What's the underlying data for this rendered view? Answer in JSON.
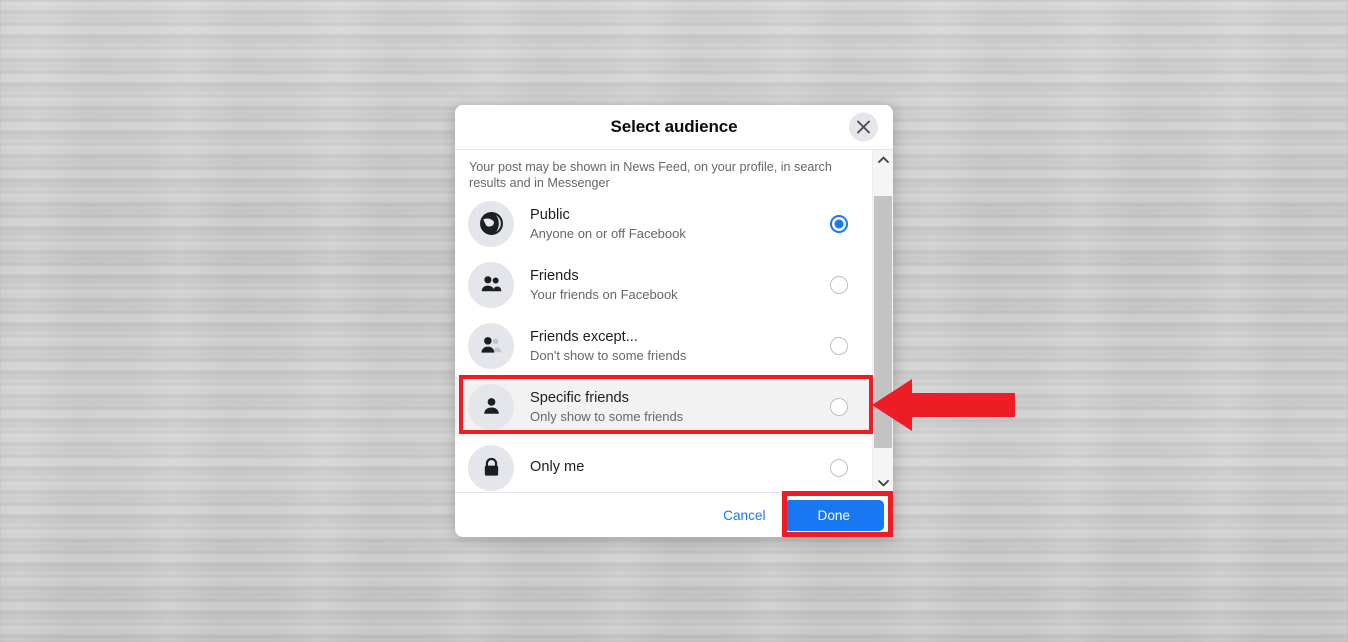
{
  "dialog": {
    "title": "Select audience",
    "close_icon": "close-icon",
    "description": "Your post may be shown in News Feed, on your profile, in search results and in Messenger",
    "options": [
      {
        "id": "public",
        "icon": "globe-icon",
        "title": "Public",
        "subtitle": "Anyone on or off Facebook",
        "selected": true
      },
      {
        "id": "friends",
        "icon": "friends-group-icon",
        "title": "Friends",
        "subtitle": "Your friends on Facebook",
        "selected": false
      },
      {
        "id": "friends-except",
        "icon": "friends-except-icon",
        "title": "Friends except...",
        "subtitle": "Don't show to some friends",
        "selected": false
      },
      {
        "id": "specific-friends",
        "icon": "person-icon",
        "title": "Specific friends",
        "subtitle": "Only show to some friends",
        "selected": false
      },
      {
        "id": "only-me",
        "icon": "lock-icon",
        "title": "Only me",
        "subtitle": "",
        "selected": false
      }
    ],
    "footer": {
      "cancel_label": "Cancel",
      "done_label": "Done"
    },
    "scrollbar": {
      "up_arrow_icon": "chevron-up-icon",
      "down_arrow_icon": "chevron-down-icon"
    }
  },
  "annotations": {
    "highlight_color": "#ee1c25",
    "highlighted_option": "Specific friends",
    "highlighted_button": "Done",
    "arrow": "left-pointing-arrow"
  },
  "colors": {
    "accent": "#1877f2",
    "text_primary": "#1c1e21",
    "text_secondary": "#65676b",
    "dialog_background": "#ffffff",
    "avatar_background": "#e4e6eb"
  }
}
